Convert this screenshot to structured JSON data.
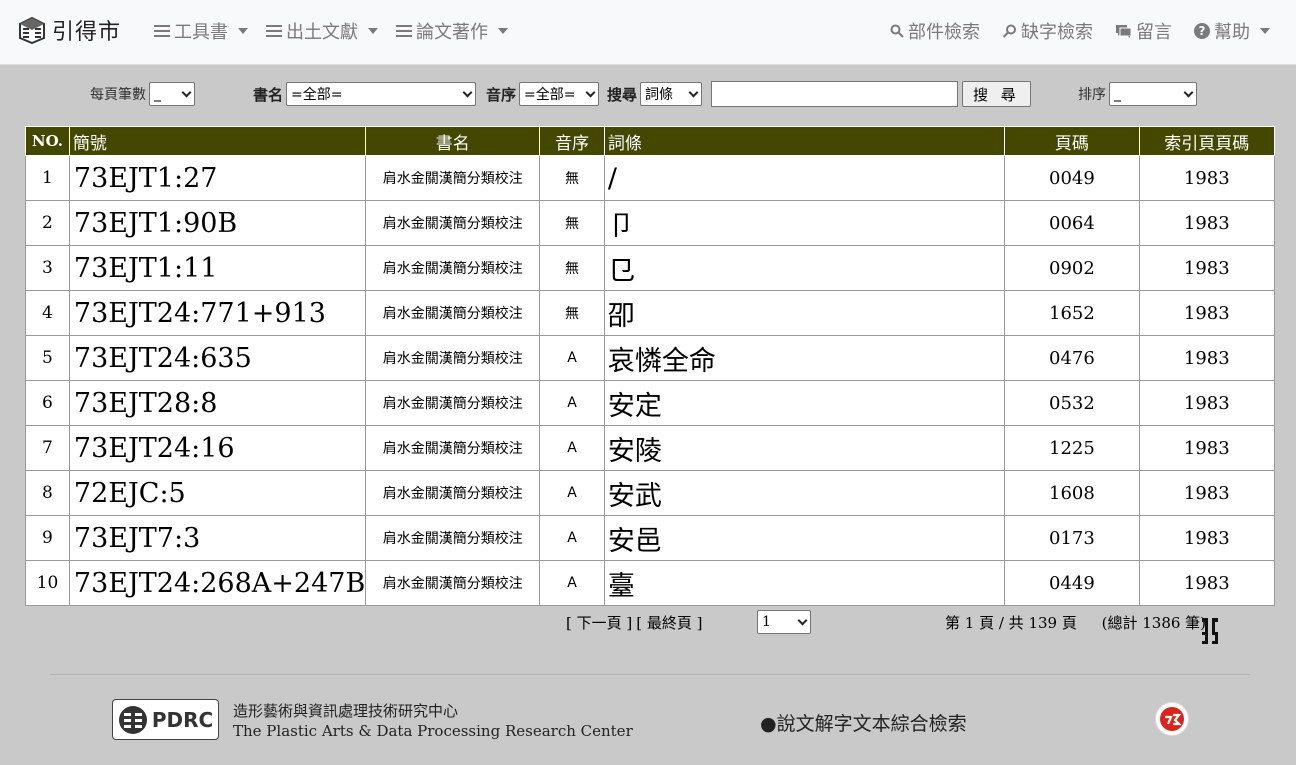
{
  "brand": {
    "name": "引得市"
  },
  "nav": {
    "left": [
      {
        "label": "工具書"
      },
      {
        "label": "出土文獻"
      },
      {
        "label": "論文著作"
      }
    ],
    "right": [
      {
        "label": "部件檢索",
        "icon": "search-icon"
      },
      {
        "label": "缺字檢索",
        "icon": "key-search-icon"
      },
      {
        "label": "留言",
        "icon": "chat-icon"
      },
      {
        "label": "幫助",
        "icon": "help-icon"
      }
    ]
  },
  "search": {
    "per_page_label": "每頁筆數",
    "per_page_value": "_",
    "book_label": "書名",
    "book_value": "=全部=",
    "order_label": "音序",
    "order_value": "=全部=",
    "search_label": "搜尋",
    "field_value": "詞條",
    "query_value": "",
    "button_label": "搜 尋",
    "sort_label": "排序",
    "sort_value": "_"
  },
  "table": {
    "headers": {
      "no": "NO.",
      "id": "簡號",
      "book": "書名",
      "order": "音序",
      "term": "詞條",
      "page": "頁碼",
      "index_page": "索引頁頁碼"
    },
    "rows": [
      {
        "no": "1",
        "id": "73EJT1:27",
        "book": "肩水金關漢簡分類校注",
        "order": "無",
        "term": "/",
        "page": "0049",
        "index_page": "1983"
      },
      {
        "no": "2",
        "id": "73EJT1:90B",
        "book": "肩水金關漢簡分類校注",
        "order": "無",
        "term": "卩",
        "page": "0064",
        "index_page": "1983"
      },
      {
        "no": "3",
        "id": "73EJT1:11",
        "book": "肩水金關漢簡分類校注",
        "order": "無",
        "term": "㔾",
        "page": "0902",
        "index_page": "1983"
      },
      {
        "no": "4",
        "id": "73EJT24:771+913",
        "book": "肩水金關漢簡分類校注",
        "order": "無",
        "term": "卲",
        "page": "1652",
        "index_page": "1983"
      },
      {
        "no": "5",
        "id": "73EJT24:635",
        "book": "肩水金關漢簡分類校注",
        "order": "A",
        "term": "哀憐全命",
        "page": "0476",
        "index_page": "1983"
      },
      {
        "no": "6",
        "id": "73EJT28:8",
        "book": "肩水金關漢簡分類校注",
        "order": "A",
        "term": "安定",
        "page": "0532",
        "index_page": "1983"
      },
      {
        "no": "7",
        "id": "73EJT24:16",
        "book": "肩水金關漢簡分類校注",
        "order": "A",
        "term": "安陵",
        "page": "1225",
        "index_page": "1983"
      },
      {
        "no": "8",
        "id": "72EJC:5",
        "book": "肩水金關漢簡分類校注",
        "order": "A",
        "term": "安武",
        "page": "1608",
        "index_page": "1983"
      },
      {
        "no": "9",
        "id": "73EJT7:3",
        "book": "肩水金關漢簡分類校注",
        "order": "A",
        "term": "安邑",
        "page": "0173",
        "index_page": "1983"
      },
      {
        "no": "10",
        "id": "73EJT24:268A+247B",
        "book": "肩水金關漢簡分類校注",
        "order": "A",
        "term": "臺",
        "page": "0449",
        "index_page": "1983"
      }
    ]
  },
  "pagination": {
    "next": "[ 下一頁 ]",
    "last": "[ 最終頁 ]",
    "page_select": "1",
    "page_info": "第 1 頁 / 共 139 頁",
    "total": "(總計 1386 筆)"
  },
  "footer": {
    "logo_text": "PDRC",
    "org_zh": "造形藝術與資訊處理技術研究中心",
    "org_en": "The Plastic Arts & Data Processing Research Center",
    "link": "●說文解字文本綜合檢索"
  },
  "colors": {
    "header_bg": "#434700",
    "page_bg": "#c9c9c9",
    "nav_bg": "#f8f9fa"
  }
}
